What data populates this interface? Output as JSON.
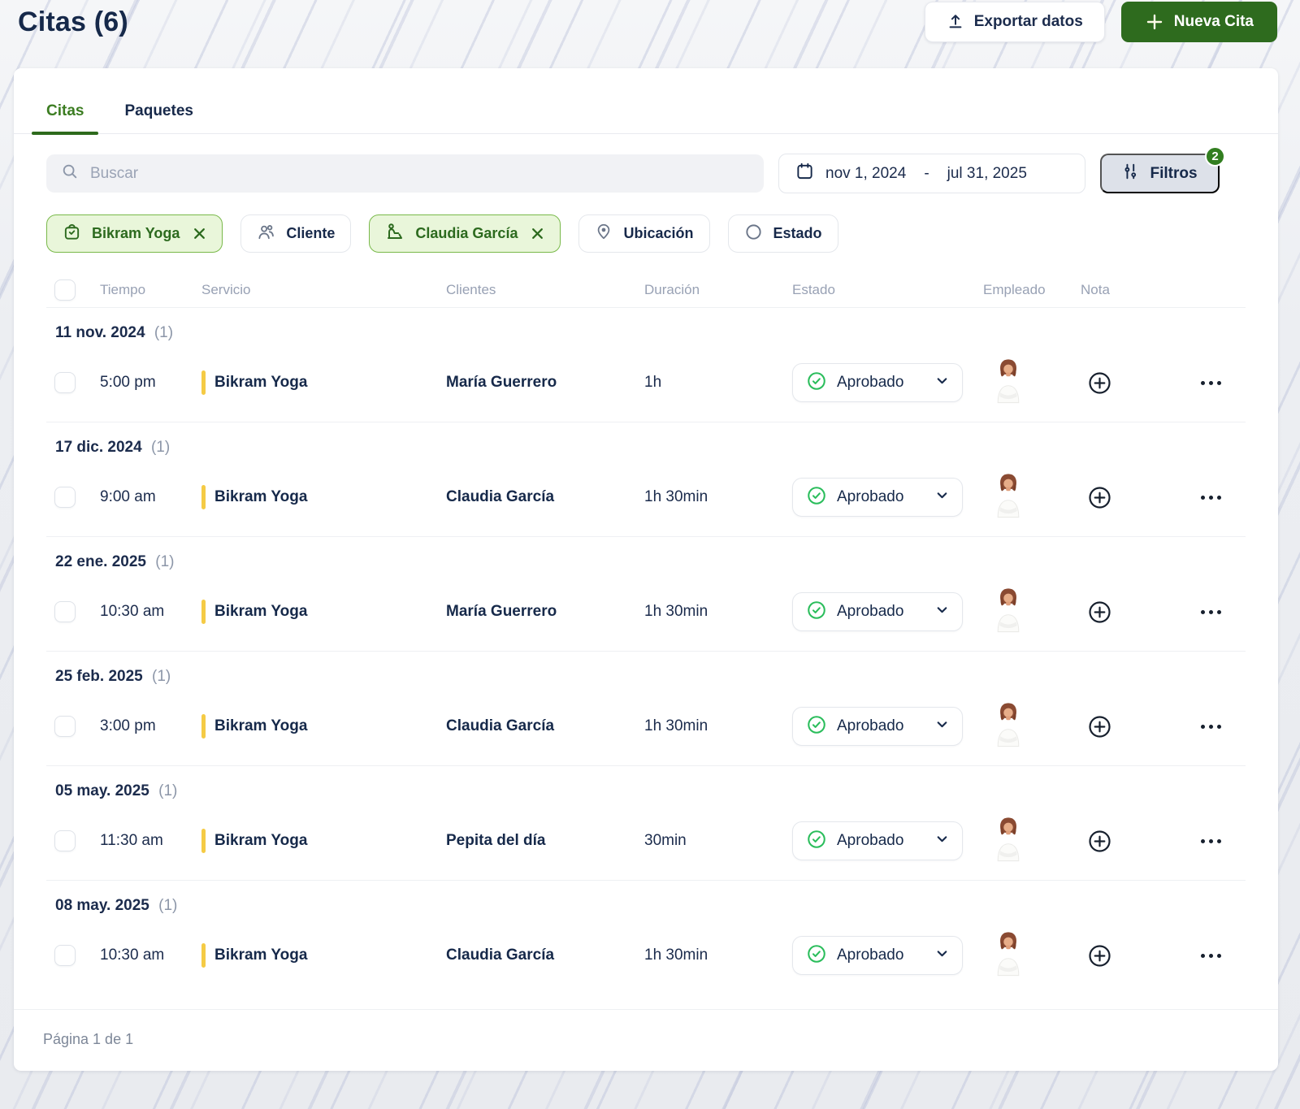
{
  "page": {
    "title": "Citas (6)",
    "export_label": "Exportar datos",
    "new_appointment_label": "Nueva Cita"
  },
  "tabs": [
    {
      "label": "Citas",
      "active": true
    },
    {
      "label": "Paquetes",
      "active": false
    }
  ],
  "toolbar": {
    "search_placeholder": "Buscar",
    "date_start": "nov 1, 2024",
    "date_separator": "-",
    "date_end": "jul 31, 2025",
    "filters_label": "Filtros",
    "filters_count": "2"
  },
  "filter_chips": [
    {
      "label": "Bikram Yoga",
      "icon": "service-bag-icon",
      "active": true,
      "removable": true
    },
    {
      "label": "Cliente",
      "icon": "clients-icon",
      "active": false,
      "removable": false
    },
    {
      "label": "Claudia García",
      "icon": "client-desk-icon",
      "active": true,
      "removable": true
    },
    {
      "label": "Ubicación",
      "icon": "location-pin-icon",
      "active": false,
      "removable": false
    },
    {
      "label": "Estado",
      "icon": "status-circle-icon",
      "active": false,
      "removable": false
    }
  ],
  "table": {
    "headers": [
      "Tiempo",
      "Servicio",
      "Clientes",
      "Duración",
      "Estado",
      "Empleado",
      "Nota"
    ],
    "groups": [
      {
        "date": "11 nov. 2024",
        "count": "(1)",
        "row": {
          "time": "5:00 pm",
          "service": "Bikram Yoga",
          "client": "María Guerrero",
          "duration": "1h",
          "status": "Aprobado"
        }
      },
      {
        "date": "17 dic. 2024",
        "count": "(1)",
        "row": {
          "time": "9:00 am",
          "service": "Bikram Yoga",
          "client": "Claudia García",
          "duration": "1h 30min",
          "status": "Aprobado"
        }
      },
      {
        "date": "22 ene. 2025",
        "count": "(1)",
        "row": {
          "time": "10:30 am",
          "service": "Bikram Yoga",
          "client": "María Guerrero",
          "duration": "1h 30min",
          "status": "Aprobado"
        }
      },
      {
        "date": "25 feb. 2025",
        "count": "(1)",
        "row": {
          "time": "3:00 pm",
          "service": "Bikram Yoga",
          "client": "Claudia García",
          "duration": "1h 30min",
          "status": "Aprobado"
        }
      },
      {
        "date": "05 may. 2025",
        "count": "(1)",
        "row": {
          "time": "11:30 am",
          "service": "Bikram Yoga",
          "client": "Pepita del día",
          "duration": "30min",
          "status": "Aprobado"
        }
      },
      {
        "date": "08 may. 2025",
        "count": "(1)",
        "row": {
          "time": "10:30 am",
          "service": "Bikram Yoga",
          "client": "Claudia García",
          "duration": "1h 30min",
          "status": "Aprobado"
        }
      }
    ]
  },
  "footer": {
    "pagination": "Página 1 de 1"
  },
  "colors": {
    "brand_green": "#2e6b1e",
    "chip_green_bg": "#e9f6da",
    "chip_green_border": "#79b94a",
    "status_check_green": "#2abd5b",
    "badge_green": "#327e20",
    "service_bar_yellow": "#f5cb45",
    "text_navy": "#1b2b4c"
  }
}
